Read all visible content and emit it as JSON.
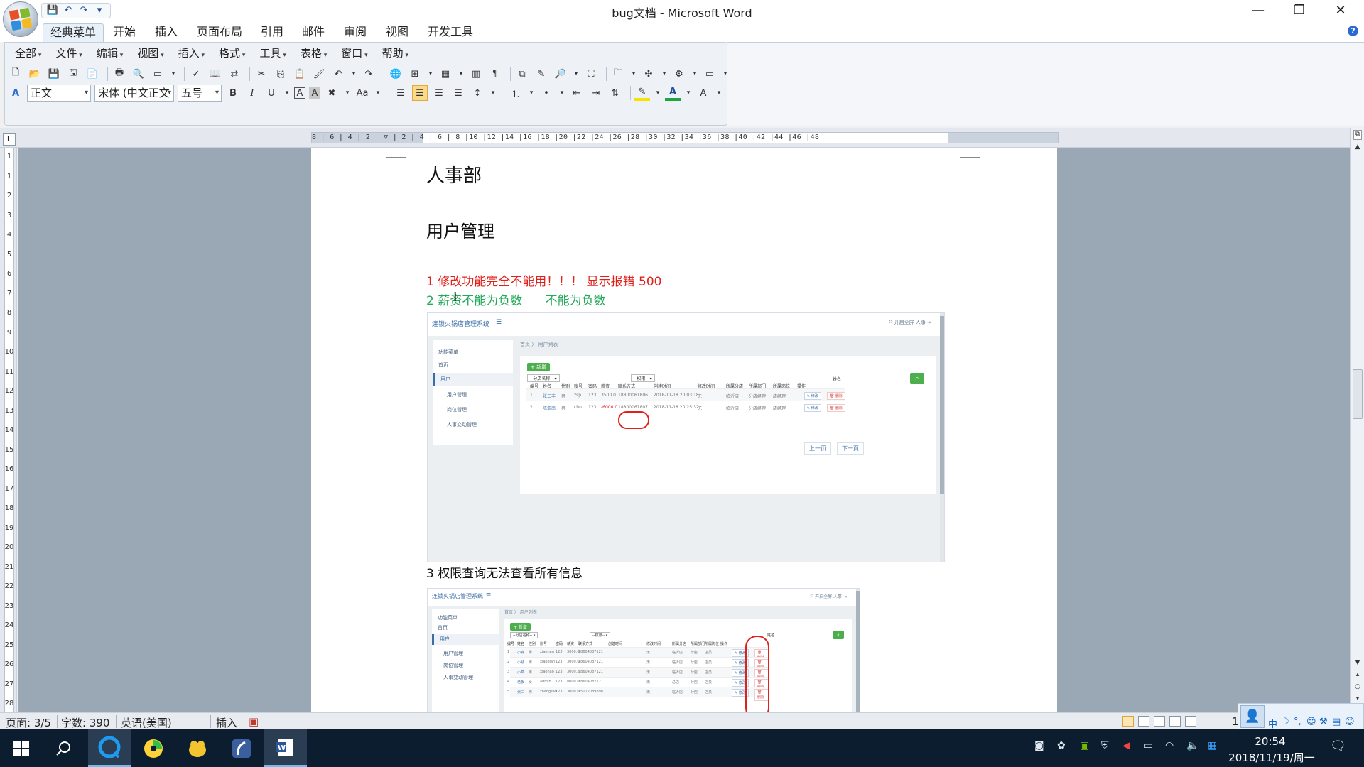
{
  "window": {
    "title": "bug文档 - Microsoft Word",
    "minimize": "—",
    "restore": "❐",
    "close": "✕"
  },
  "qat": {
    "save": "💾",
    "undo": "↶",
    "redo": "↷",
    "customize": "▾"
  },
  "tabs": [
    {
      "label": "经典菜单"
    },
    {
      "label": "开始"
    },
    {
      "label": "插入"
    },
    {
      "label": "页面布局"
    },
    {
      "label": "引用"
    },
    {
      "label": "邮件"
    },
    {
      "label": "审阅"
    },
    {
      "label": "视图"
    },
    {
      "label": "开发工具"
    }
  ],
  "menus": [
    {
      "label": "全部"
    },
    {
      "label": "文件"
    },
    {
      "label": "编辑"
    },
    {
      "label": "视图"
    },
    {
      "label": "插入"
    },
    {
      "label": "格式"
    },
    {
      "label": "工具"
    },
    {
      "label": "表格"
    },
    {
      "label": "窗口"
    },
    {
      "label": "帮助"
    }
  ],
  "format": {
    "style": "正文",
    "font": "宋体 (中文正文",
    "size": "五号"
  },
  "ruler": {
    "h": "8 | 6 | 4 | 2 | ▽ | 2 | 4 | 6 | 8 |10 |12 |14 |16 |18 |20 |22 |24 |26 |28 |30 |32 |34 |36 |38 |40 |42 |44 |46 |48",
    "v": [
      "1",
      "1",
      "2",
      "3",
      "4",
      "5",
      "6",
      "7",
      "8",
      "9",
      "10",
      "11",
      "12",
      "13",
      "14",
      "15",
      "16",
      "17",
      "18",
      "19",
      "20",
      "21",
      "22",
      "23",
      "24",
      "25",
      "26",
      "27",
      "28"
    ]
  },
  "doc": {
    "heading1": "人事部",
    "heading2": "用户管理",
    "bug1": "1 修改功能完全不能用！！！ 显示报错 500",
    "bug2": "2 薪资不能为负数      不能为负数",
    "bug3": "3 权限查询无法查看所有信息",
    "colors": {
      "bug1": "#e0211b",
      "bug2": "#25a95a",
      "circle": "#e0211b"
    }
  },
  "shot1": {
    "brand": "连锁火锅店管理系统",
    "top_right": "⤧ 开启全屏    人事    ⇥",
    "side_title": "功能菜单",
    "side_items": [
      "首页",
      "用户",
      "用户管理",
      "岗位管理",
      "人事变动管理"
    ],
    "crumb": "首页  〉 用户列表",
    "add": "+ 新增",
    "select1": "--分店名称-- ▾",
    "select2": "--权限-- ▾",
    "search_label": "姓名",
    "search": "⌕",
    "headers": [
      "编号",
      "姓名",
      "性别",
      "账号",
      "密码",
      "薪资",
      "联系方式",
      "创建时间",
      "修改时间",
      "所属分店",
      "所属部门",
      "所属岗位",
      "操作"
    ],
    "rows": [
      [
        "1",
        "张三丰",
        "男",
        "zsp",
        "123",
        "3500.0",
        "18800061806",
        "2018-11-18 20:03:18",
        "无",
        "临沂店",
        "分店经理",
        "店经理"
      ],
      [
        "2",
        "陈浩南",
        "男",
        "chn",
        "123",
        "-6000.0",
        "18800061807",
        "2018-11-18 20:25:32",
        "无",
        "临沂店",
        "分店经理",
        "店经理"
      ]
    ],
    "edit": "✎ 修改",
    "delete": "🗑 删除",
    "prev": "上一页",
    "next": "下一页"
  },
  "shot2": {
    "brand": "连锁火锅店管理系统",
    "top_right": "⤧ 开启全屏    人事    ⇥",
    "side_title": "功能菜单",
    "side_items": [
      "首页",
      "用户",
      "用户管理",
      "岗位管理",
      "人事变动管理"
    ],
    "crumb": "首页  〉 用户列表",
    "add": "+ 新增",
    "select1": "--分店名称-- ▾",
    "select2": "--权限-- ▾",
    "search_label": "姓名",
    "search": "⌕",
    "headers": [
      "编号",
      "姓名",
      "性别",
      "账号",
      "密码",
      "薪资",
      "联系方式",
      "创建时间",
      "修改时间",
      "所属分店",
      "所属部门",
      "所属岗位",
      "操作"
    ],
    "rows": [
      [
        "1",
        "小森",
        "男",
        "xiaohan",
        "123",
        "3000.0",
        "18604087121",
        "无",
        "临沂店",
        "分店",
        "店员"
      ],
      [
        "2",
        "小钱",
        "男",
        "xiaoqian",
        "123",
        "3000.0",
        "18604087121",
        "无",
        "临沂店",
        "分店",
        "店员"
      ],
      [
        "3",
        "小高",
        "男",
        "xiaohao",
        "123",
        "3000.2",
        "18604087121",
        "无",
        "临沂店",
        "分店",
        "店员"
      ],
      [
        "4",
        "老板",
        "女",
        "admin",
        "123",
        "8000.0",
        "18604087121",
        "无",
        "总店",
        "分店",
        "店员"
      ],
      [
        "5",
        "张三",
        "男",
        "zhangsan",
        "123",
        "3000.0",
        "15112089898",
        "无",
        "临沂店",
        "分店",
        "店员"
      ]
    ],
    "edit": "✎ 修改",
    "delete": "🗑 删除"
  },
  "status": {
    "page": "页面: 3/5",
    "words": "字数: 390",
    "lang": "英语(美国)",
    "mode": "插入",
    "zoom": "106%"
  },
  "ime": {
    "items": [
      "中",
      "☽",
      "°,",
      "☺",
      "⚒",
      "▤",
      "☺"
    ],
    "avatar": "👤"
  },
  "taskbar": {
    "time": "20:54",
    "date": "2018/11/19/周一"
  }
}
